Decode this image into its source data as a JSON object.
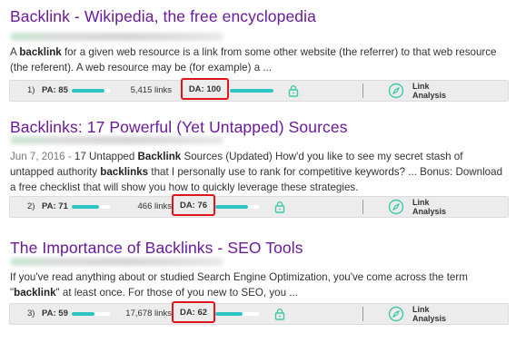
{
  "results": [
    {
      "title": "Backlink - Wikipedia, the free encyclopedia",
      "snippet": {
        "date": "",
        "parts": [
          {
            "t": "A ",
            "b": false
          },
          {
            "t": "backlink",
            "b": true
          },
          {
            "t": " for a given web resource is a link from some other website (the referrer) to that web resource (the referent). A web resource may be (for example) a ...",
            "b": false
          }
        ]
      },
      "mozbar": {
        "rank": "1)",
        "pa_label": "PA: 85",
        "pa_value": 85,
        "links": "5,415 links",
        "da_label": "DA: 100",
        "da_value": 100,
        "link_analysis": [
          "Link",
          "Analysis"
        ]
      }
    },
    {
      "title": "Backlinks: 17 Powerful (Yet Untapped) Sources",
      "snippet": {
        "date": "Jun 7, 2016 - ",
        "parts": [
          {
            "t": "17 Untapped ",
            "b": false
          },
          {
            "t": "Backlink",
            "b": true
          },
          {
            "t": " Sources (Updated) How'd you like to see my secret stash of untapped authority ",
            "b": false
          },
          {
            "t": "backlinks",
            "b": true
          },
          {
            "t": " that I personally use to rank for competitive keywords? ... Bonus: Download a free checklist that will show you how to quickly leverage these strategies.",
            "b": false
          }
        ]
      },
      "mozbar": {
        "rank": "2)",
        "pa_label": "PA: 71",
        "pa_value": 71,
        "links": "466 links",
        "da_label": "DA: 76",
        "da_value": 76,
        "link_analysis": [
          "Link",
          "Analysis"
        ]
      }
    },
    {
      "title": "The Importance of Backlinks - SEO Tools",
      "snippet": {
        "date": "",
        "parts": [
          {
            "t": "If you've read anything about or studied Search Engine Optimization, you've come across the term \"",
            "b": false
          },
          {
            "t": "backlink",
            "b": true
          },
          {
            "t": "\" at least once. For those of you new to SEO, you ...",
            "b": false
          }
        ]
      },
      "mozbar": {
        "rank": "3)",
        "pa_label": "PA: 59",
        "pa_value": 59,
        "links": "17,678 links",
        "da_label": "DA: 62",
        "da_value": 62,
        "link_analysis": [
          "Link",
          "Analysis"
        ]
      }
    }
  ],
  "colors": {
    "title": "#6a1a9a",
    "bar_fill": "#2ec4c4",
    "highlight_box": "#e0141c",
    "icon_teal": "#3ec9a8"
  },
  "icons": [
    "lock-icon",
    "compass-icon"
  ]
}
